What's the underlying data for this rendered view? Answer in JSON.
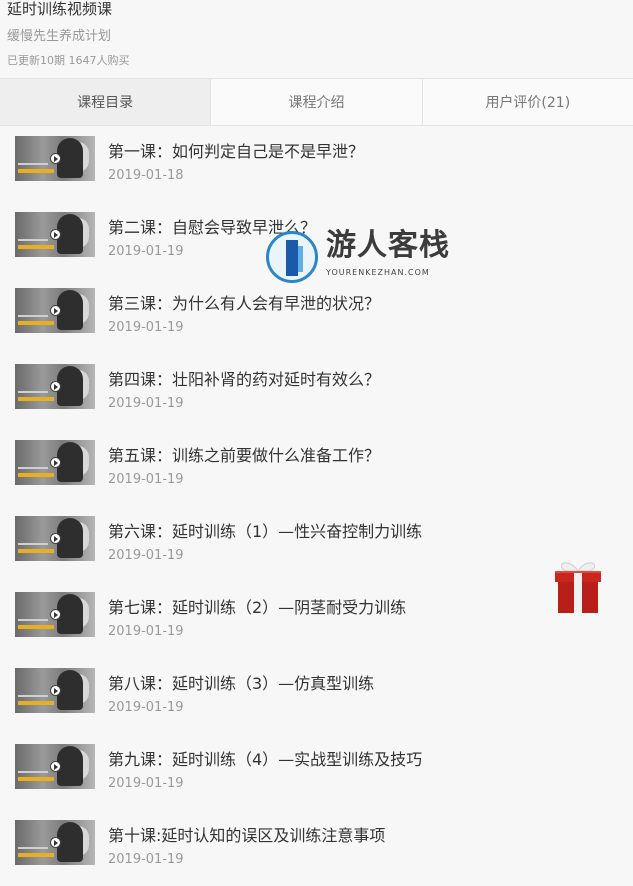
{
  "course": {
    "title": "延时训练视频课",
    "author": "缓慢先生养成计划",
    "stats": "已更新10期 1647人购买"
  },
  "tabs": [
    {
      "label": "课程目录",
      "active": true
    },
    {
      "label": "课程介绍",
      "active": false
    },
    {
      "label": "用户评价(21)",
      "active": false
    }
  ],
  "lessons": [
    {
      "title": "第一课：如何判定自己是不是早泄？",
      "date": "2019-01-18"
    },
    {
      "title": "第二课：自慰会导致早泄么？",
      "date": "2019-01-19"
    },
    {
      "title": "第三课：为什么有人会有早泄的状况？",
      "date": "2019-01-19"
    },
    {
      "title": "第四课：壮阳补肾的药对延时有效么？",
      "date": "2019-01-19"
    },
    {
      "title": "第五课：训练之前要做什么准备工作？",
      "date": "2019-01-19"
    },
    {
      "title": "第六课：延时训练（1）—性兴奋控制力训练",
      "date": "2019-01-19"
    },
    {
      "title": "第七课：延时训练（2）—阴茎耐受力训练",
      "date": "2019-01-19"
    },
    {
      "title": "第八课：延时训练（3）—仿真型训练",
      "date": "2019-01-19"
    },
    {
      "title": "第九课：延时训练（4）—实战型训练及技巧",
      "date": "2019-01-19"
    },
    {
      "title": "第十课:延时认知的误区及训练注意事项",
      "date": "2019-01-19"
    }
  ],
  "watermark": {
    "name": "游人客栈",
    "url": "YOURENKEZHAN.COM"
  },
  "colors": {
    "background": "#f7f7f7",
    "text": "#333333",
    "muted": "#999999",
    "gift_red": "#c9261d",
    "gift_ribbon": "#f1f1f1",
    "logo_blue": "#1b5aa8"
  },
  "icons": {
    "play": "play-icon",
    "gift": "gift-icon"
  }
}
